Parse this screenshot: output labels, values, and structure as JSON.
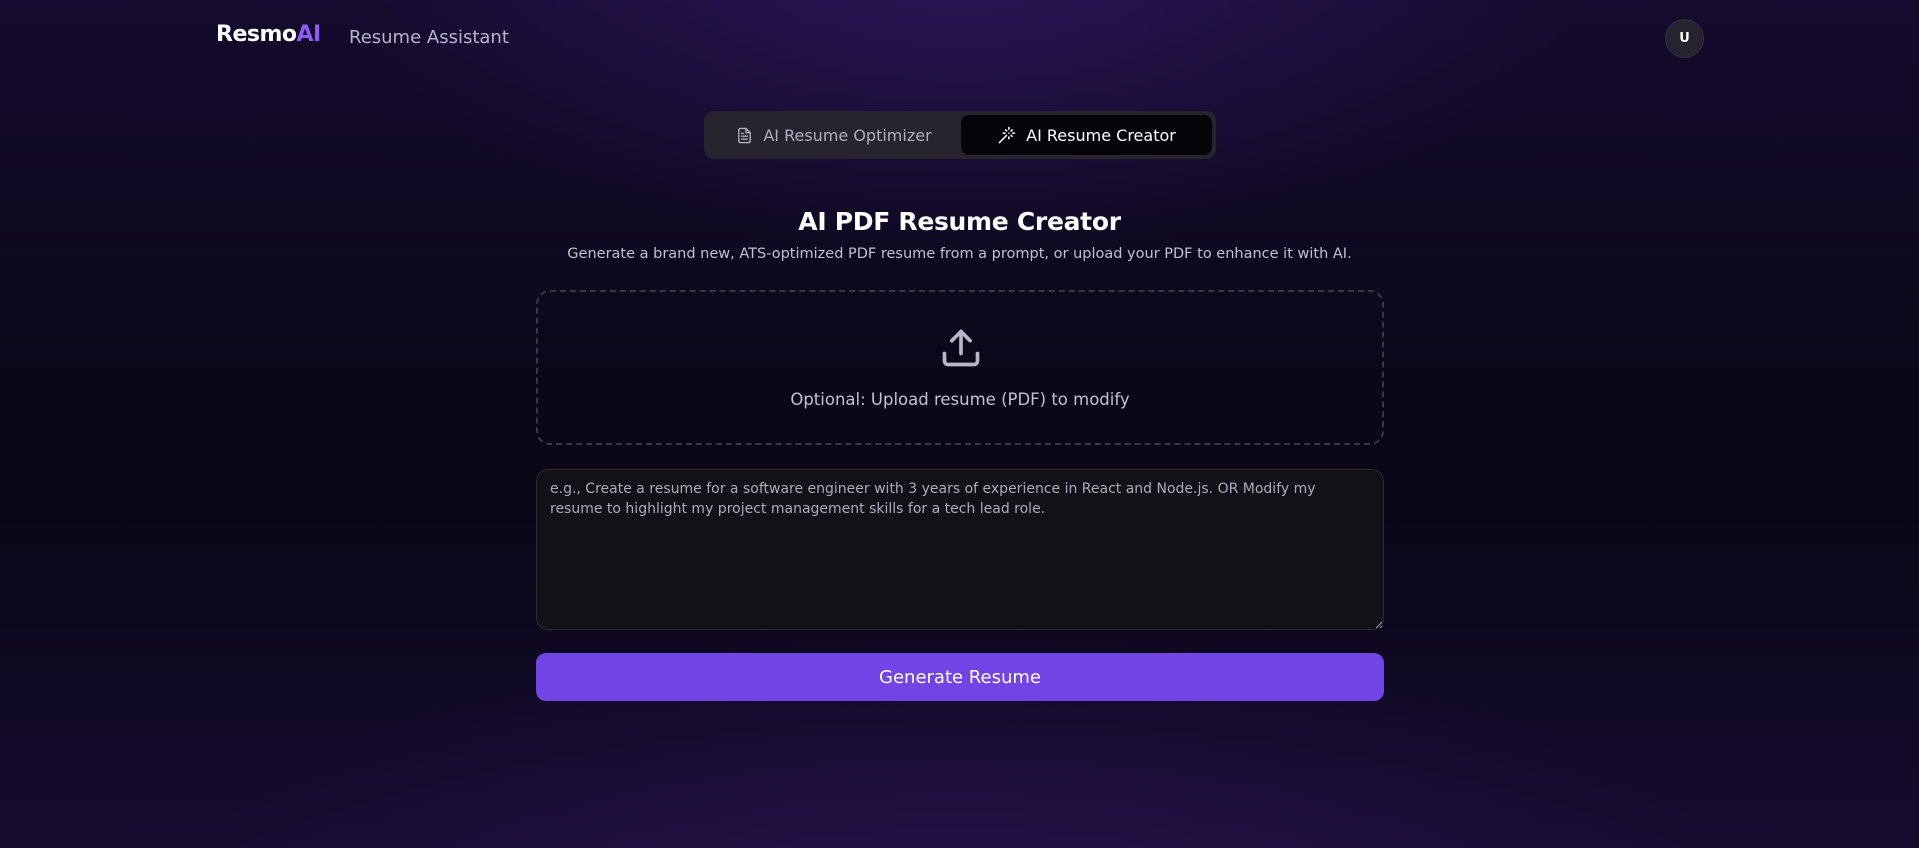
{
  "header": {
    "logo_main": "Resmo",
    "logo_accent": "AI",
    "app_name": "Resume Assistant",
    "avatar_initial": "U"
  },
  "tabs": [
    {
      "label": "AI Resume Optimizer",
      "icon": "document-icon",
      "active": false
    },
    {
      "label": "AI Resume Creator",
      "icon": "magic-wand-icon",
      "active": true
    }
  ],
  "main": {
    "title": "AI PDF Resume Creator",
    "subtitle": "Generate a brand new, ATS-optimized PDF resume from a prompt, or upload your PDF to enhance it with AI.",
    "upload": {
      "icon": "upload-icon",
      "label": "Optional: Upload resume (PDF) to modify"
    },
    "prompt": {
      "value": "",
      "placeholder": "e.g., Create a resume for a software engineer with 3 years of experience in React and Node.js. OR Modify my resume to highlight my project management skills for a tech lead role."
    },
    "generate_label": "Generate Resume"
  },
  "colors": {
    "accent": "#7244e6",
    "logo_accent": "#8b5cf6",
    "background": "#0b0718"
  }
}
